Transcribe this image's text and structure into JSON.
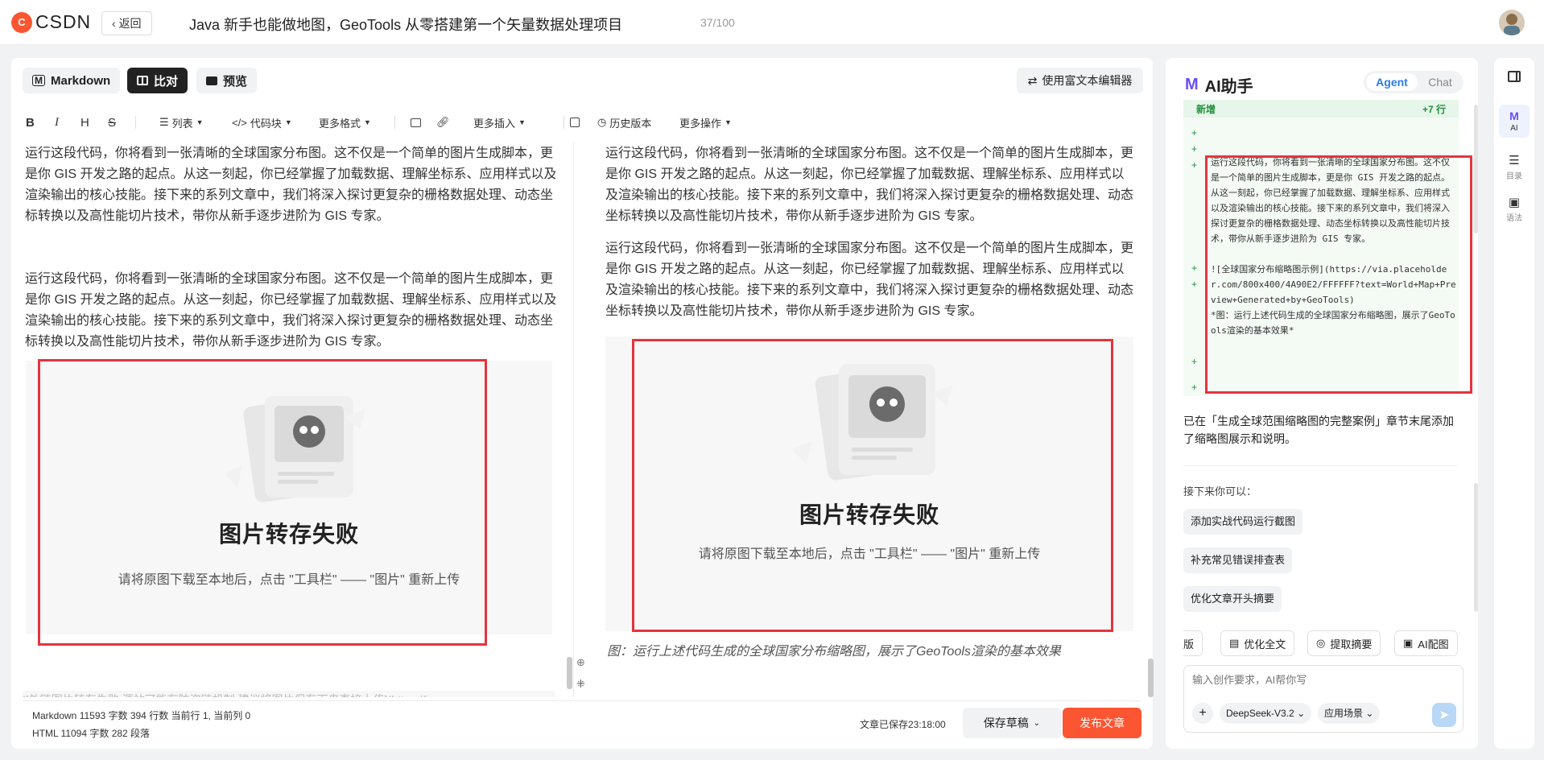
{
  "header": {
    "logo_text": "CSDN",
    "back_label": "返回",
    "title": "Java 新手也能做地图，GeoTools 从零搭建第一个矢量数据处理项目",
    "title_count": "37/100"
  },
  "modes": {
    "markdown": "Markdown",
    "compare": "比对",
    "preview": "预览",
    "rich_editor": "使用富文本编辑器"
  },
  "toolbar": {
    "list": "列表",
    "code_block": "代码块",
    "more_format": "更多格式",
    "more_insert": "更多插入",
    "history": "历史版本",
    "more_actions": "更多操作"
  },
  "editor": {
    "paragraph": "运行这段代码，你将看到一张清晰的全球国家分布图。这不仅是一个简单的图片生成脚本，更是你 GIS 开发之路的起点。从这一刻起，你已经掌握了加载数据、理解坐标系、应用样式以及渲染输出的核心技能。接下来的系列文章中，我们将深入探讨更复杂的栅格数据处理、动态坐标转换以及高性能切片技术，带你从新手逐步进阶为 GIS 专家。",
    "left_overflow": "![外链图片转存失败,源站可能有防盗链机制,建议将图片保存下来直接上传](https://img"
  },
  "image_fail": {
    "title": "图片转存失败",
    "hint": "请将原图下载至本地后，点击 \"工具栏\" —— \"图片\" 重新上传"
  },
  "preview": {
    "caption": "图：运行上述代码生成的全球国家分布缩略图，展示了GeoTools渲染的基本效果"
  },
  "status": {
    "markdown_line": "Markdown   11593 字数   394 行数   当前行 1, 当前列 0",
    "html_line": "HTML   11094 字数   282 段落",
    "saved": "文章已保存23:18:00",
    "save_draft": "保存草稿",
    "publish": "发布文章"
  },
  "ai": {
    "title": "AI助手",
    "tab_agent": "Agent",
    "tab_chat": "Chat",
    "diff_label": "新增",
    "diff_count": "+7 行",
    "diff_text": "运行这段代码，你将看到一张清晰的全球国家分布图。这不仅是一个简单的图片生成脚本，更是你 GIS 开发之路的起点。从这一刻起，你已经掌握了加载数据、理解坐标系、应用样式以及渲染输出的核心技能。接下来的系列文章中，我们将深入探讨更复杂的栅格数据处理、动态坐标转换以及高性能切片技术，带你从新手逐步进阶为 GIS 专家。\n\n![全球国家分布缩略图示例](https://via.placeholder.com/800x400/4A90E2/FFFFFF?text=World+Map+Preview+Generated+by+GeoTools)\n*图：运行上述代码生成的全球国家分布缩略图，展示了GeoTools渲染的基本效果*",
    "message": "已在「生成全球范围缩略图的完整案例」章节末尾添加了缩略图展示和说明。",
    "next_label": "接下来你可以：",
    "suggestions": [
      "添加实战代码运行截图",
      "补充常见错误排查表",
      "优化文章开头摘要"
    ],
    "quick_actions": [
      "排版",
      "优化全文",
      "提取摘要",
      "AI配图"
    ],
    "input_placeholder": "输入创作要求，AI帮你写",
    "model": "DeepSeek-V3.2",
    "scene": "应用场景"
  },
  "rail": {
    "ai": "AI",
    "toc": "目录",
    "grammar": "语法"
  }
}
